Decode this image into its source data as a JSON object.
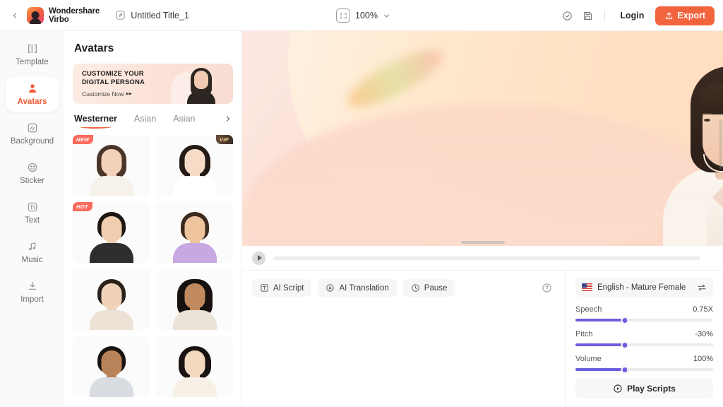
{
  "header": {
    "back_icon": "chevron-left-icon",
    "brand_line1": "Wondershare",
    "brand_line2": "Virbo",
    "doc_edit_icon": "edit-pencil-icon",
    "doc_title": "Untitled Title_1",
    "zoom_fit_icon": "fit-to-screen-icon",
    "zoom_value": "100%",
    "zoom_chevron_icon": "chevron-down-icon",
    "check_icon": "check-circle-icon",
    "save_icon": "save-disk-icon",
    "login_label": "Login",
    "export_icon": "upload-icon",
    "export_label": "Export",
    "accent_color": "#f2643e"
  },
  "sidebar": {
    "items": [
      {
        "label": "Template",
        "icon": "template-icon",
        "active": false
      },
      {
        "label": "Avatars",
        "icon": "avatar-person-icon",
        "active": true
      },
      {
        "label": "Background",
        "icon": "background-icon",
        "active": false
      },
      {
        "label": "Sticker",
        "icon": "sticker-smiley-icon",
        "active": false
      },
      {
        "label": "Text",
        "icon": "text-ti-icon",
        "active": false
      },
      {
        "label": "Music",
        "icon": "music-note-icon",
        "active": false
      },
      {
        "label": "Import",
        "icon": "import-download-icon",
        "active": false
      }
    ],
    "active_color": "#ed5a33"
  },
  "panel": {
    "title": "Avatars",
    "promo": {
      "headline_line1": "CUSTOMIZE YOUR",
      "headline_line2": "DIGITAL PERSONA",
      "cta": "Customize Now",
      "cta_arrow": "▸▸"
    },
    "tabs": [
      {
        "label": "Westerner",
        "active": true
      },
      {
        "label": "Asian",
        "active": false
      },
      {
        "label": "Asian",
        "active": false
      }
    ],
    "tabs_next_icon": "chevron-right-icon",
    "avatars": [
      {
        "badge": "NEW",
        "badge_type": "new",
        "hair": "#4b3529",
        "skin": "#f2d2bb",
        "cloth": "#f6f1ea",
        "hair_w": 42,
        "hair_h": 48
      },
      {
        "badge": "VIP",
        "badge_type": "vip",
        "hair": "#241b16",
        "skin": "#f6dcc6",
        "cloth": "#ffffff",
        "hair_w": 44,
        "hair_h": 46
      },
      {
        "badge": "HOT",
        "badge_type": "hot",
        "hair": "#1d1713",
        "skin": "#f0cdae",
        "cloth": "#2e2e2e",
        "hair_w": 40,
        "hair_h": 38
      },
      {
        "badge": "",
        "badge_type": "",
        "hair": "#3b2a1e",
        "skin": "#eec49e",
        "cloth": "#c8a8e0",
        "hair_w": 40,
        "hair_h": 40
      },
      {
        "badge": "",
        "badge_type": "",
        "hair": "#2a211b",
        "skin": "#f0d2b8",
        "cloth": "#ece3d6",
        "hair_w": 40,
        "hair_h": 38
      },
      {
        "badge": "",
        "badge_type": "",
        "hair": "#171210",
        "skin": "#c08a5e",
        "cloth": "#ece3d8",
        "hair_w": 50,
        "hair_h": 54
      },
      {
        "badge": "",
        "badge_type": "",
        "hair": "#1a1512",
        "skin": "#b9835a",
        "cloth": "#d9dde2",
        "hair_w": 40,
        "hair_h": 38
      },
      {
        "badge": "",
        "badge_type": "",
        "hair": "#181311",
        "skin": "#f3d9bf",
        "cloth": "#f6f0e6",
        "hair_w": 46,
        "hair_h": 46
      }
    ]
  },
  "stage": {
    "play_icon": "play-triangle-icon",
    "grip": "resize-grip-handle",
    "scrollbar": "vertical-scrollbar"
  },
  "script": {
    "buttons": [
      {
        "label": "AI Script",
        "icon": "text-box-icon"
      },
      {
        "label": "AI Translation",
        "icon": "translate-circle-icon"
      },
      {
        "label": "Pause",
        "icon": "clock-pause-icon"
      }
    ],
    "help_icon": "question-circle-icon",
    "editor_placeholder": ""
  },
  "voice": {
    "flag_icon": "us-flag-icon",
    "name": "English - Mature Female",
    "swap_icon": "swap-arrows-icon",
    "slider_color": "#6e5fe0",
    "sliders": [
      {
        "label": "Speech",
        "value": "0.75X",
        "percent": 36
      },
      {
        "label": "Pitch",
        "value": "-30%",
        "percent": 36
      },
      {
        "label": "Volume",
        "value": "100%",
        "percent": 36
      }
    ],
    "play_scripts_icon": "play-circle-icon",
    "play_scripts_label": "Play Scripts"
  }
}
